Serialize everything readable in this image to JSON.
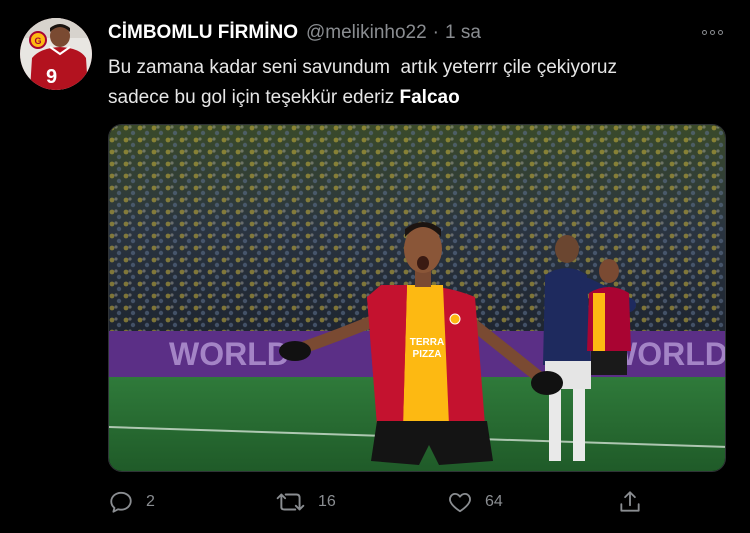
{
  "tweet": {
    "display_name": "CİMBOMLU FİRMİNO",
    "handle": "@melikinho22",
    "separator": "·",
    "time": "1 sa",
    "text_line1_part1": "Bu zamana kadar seni savundum  artık yeterrr çile çekiyoruz",
    "text_line2_part1": "sadece bu gol için teşekkür ederiz ",
    "text_line2_bold": "Falcao"
  },
  "avatar": {
    "jersey_number": "9"
  },
  "photo": {
    "board_text_left": "WORLD",
    "board_text_right": "WORLD",
    "shirt_sponsor_1": "TERRA",
    "shirt_sponsor_2": "PIZZA"
  },
  "actions": {
    "reply_count": "2",
    "retweet_count": "16",
    "like_count": "64"
  },
  "icons": {
    "reply": "reply-icon",
    "retweet": "retweet-icon",
    "like": "like-icon",
    "share": "share-icon",
    "more": "more-icon"
  },
  "colors": {
    "background": "#000000",
    "secondary_text": "#8a8d91",
    "galatasaray_red": "#a90432",
    "galatasaray_yellow": "#fdb912",
    "board_purple": "#5b2f86"
  }
}
